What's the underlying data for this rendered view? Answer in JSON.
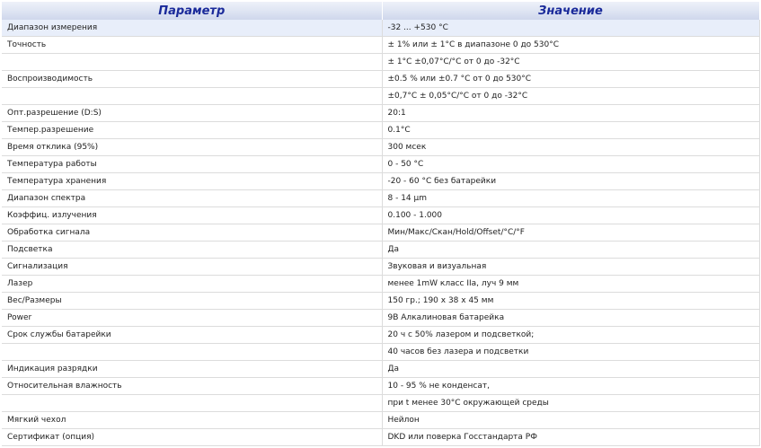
{
  "header": {
    "param": "Параметр",
    "value": "Значение"
  },
  "rows": [
    {
      "p": "Диапазон измерения",
      "v": "-32 ... +530 °C"
    },
    {
      "p": "Точность",
      "v": "± 1% или ± 1°C в диапазоне 0 до 530°C"
    },
    {
      "p": "",
      "v": "± 1°C ±0,07°C/°C от 0 до -32°C"
    },
    {
      "p": "Воспроизводимость",
      "v": "±0.5 % или ±0.7 °C от 0 до 530°C"
    },
    {
      "p": "",
      "v": "±0,7°C ± 0,05°C/°C от 0 до -32°C"
    },
    {
      "p": "Опт.разрешение (D:S)",
      "v": "20:1"
    },
    {
      "p": "Темпер.разрешение",
      "v": "0.1°C"
    },
    {
      "p": "Время отклика (95%)",
      "v": "300 мсек"
    },
    {
      "p": "Температура работы",
      "v": "0 - 50 °C"
    },
    {
      "p": "Температура хранения",
      "v": "-20 - 60 °C без батарейки"
    },
    {
      "p": "Диапазон спектра",
      "v": "8 - 14 µm"
    },
    {
      "p": "Коэффиц. излучения",
      "v": "0.100 - 1.000"
    },
    {
      "p": "Обработка сигнала",
      "v": "Мин/Макс/Скан/Hold/Offset/°C/°F"
    },
    {
      "p": "Подсветка",
      "v": "Да"
    },
    {
      "p": "Сигнализация",
      "v": "Звуковая и визуальная"
    },
    {
      "p": "Лазер",
      "v": "менее 1mW класс IIa, луч 9 мм"
    },
    {
      "p": "Вес/Размеры",
      "v": "150 гр.; 190 x 38 x 45 мм"
    },
    {
      "p": "Power",
      "v": "9В Алкалиновая батарейка"
    },
    {
      "p": "Срок службы батарейки",
      "v": "20 ч с 50% лазером и подсветкой;"
    },
    {
      "p": "",
      "v": "40 часов без лазера и подсветки"
    },
    {
      "p": "Индикация разрядки",
      "v": "Да"
    },
    {
      "p": "Относительная влажность",
      "v": "10 - 95 % не конденсат,"
    },
    {
      "p": "",
      "v": "при t менее 30°C окружающей среды"
    },
    {
      "p": "Мягкий чехол",
      "v": "Нейлон"
    },
    {
      "p": "Сертификат (опция)",
      "v": "DKD или поверка Госстандарта РФ"
    }
  ]
}
